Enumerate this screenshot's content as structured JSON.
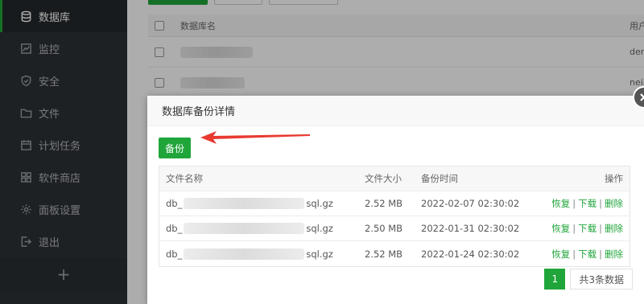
{
  "sidebar": {
    "items": [
      {
        "label": "数据库",
        "icon": "database-icon",
        "active": true
      },
      {
        "label": "监控",
        "icon": "monitor-icon"
      },
      {
        "label": "安全",
        "icon": "shield-icon"
      },
      {
        "label": "文件",
        "icon": "folder-icon"
      },
      {
        "label": "计划任务",
        "icon": "calendar-icon"
      },
      {
        "label": "软件商店",
        "icon": "apps-icon"
      },
      {
        "label": "面板设置",
        "icon": "gear-icon"
      },
      {
        "label": "退出",
        "icon": "logout-icon"
      }
    ],
    "add_label": "+"
  },
  "bg_table": {
    "header": {
      "name": "数据库名",
      "user": "用户"
    },
    "rows": [
      {
        "user": "der"
      },
      {
        "user": "neij"
      }
    ]
  },
  "modal": {
    "title": "数据库备份详情",
    "backup_button": "备份",
    "columns": {
      "name": "文件名称",
      "size": "文件大小",
      "time": "备份时间",
      "op": "操作"
    },
    "rows": [
      {
        "name_prefix": "db_",
        "name_suffix": "sql.gz",
        "size": "2.52 MB",
        "time": "2022-02-07 02:30:02"
      },
      {
        "name_prefix": "db_",
        "name_suffix": "sql.gz",
        "size": "2.50 MB",
        "time": "2022-01-31 02:30:02"
      },
      {
        "name_prefix": "db_",
        "name_suffix": "sql.gz",
        "size": "2.52 MB",
        "time": "2022-01-24 02:30:02"
      }
    ],
    "actions": {
      "restore": "恢复",
      "download": "下载",
      "delete": "删除",
      "sep": "|"
    },
    "pager": {
      "current": "1",
      "total": "共3条数据"
    }
  },
  "colors": {
    "accent": "#20a53a",
    "sidebar_bg": "#2d3136",
    "arrow": "#e83a30"
  }
}
